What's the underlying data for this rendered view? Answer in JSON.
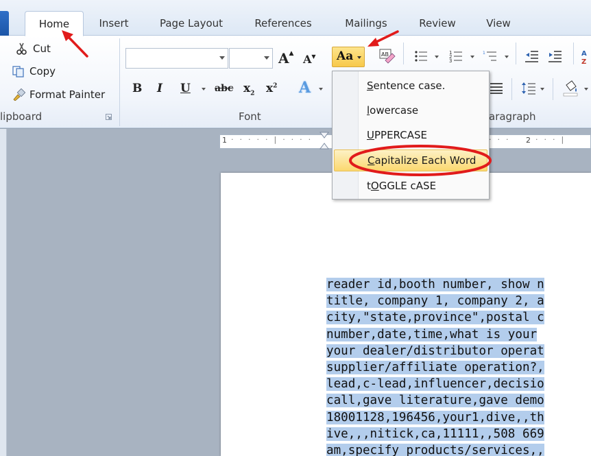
{
  "tabs": [
    {
      "label": "Home",
      "active": true
    },
    {
      "label": "Insert"
    },
    {
      "label": "Page Layout"
    },
    {
      "label": "References"
    },
    {
      "label": "Mailings"
    },
    {
      "label": "Review"
    },
    {
      "label": "View"
    }
  ],
  "clipboard": {
    "cut": "Cut",
    "copy": "Copy",
    "format_painter": "Format Painter",
    "group_label": "lipboard"
  },
  "font": {
    "group_label": "Font",
    "grow_label": "A",
    "shrink_label": "A",
    "change_case_label": "Aa",
    "bold": "B",
    "italic": "I",
    "underline": "U",
    "strikethrough": "abc",
    "subscript": "x",
    "superscript": "x",
    "text_effects": "A"
  },
  "paragraph": {
    "group_label": "aragraph"
  },
  "ruler": {
    "marks": [
      "1",
      "2"
    ]
  },
  "change_case_menu": {
    "items": [
      {
        "prefix": "",
        "ul": "S",
        "rest": "entence case."
      },
      {
        "prefix": "",
        "ul": "l",
        "rest": "owercase"
      },
      {
        "prefix": "",
        "ul": "U",
        "rest": "PPERCASE"
      },
      {
        "prefix": "",
        "ul": "C",
        "rest": "apitalize Each Word"
      },
      {
        "prefix": "t",
        "ul": "O",
        "rest": "GGLE cASE"
      }
    ],
    "highlighted_index": 3
  },
  "document": {
    "lines": [
      "reader id,booth number, show n",
      "title, company 1, company 2, a",
      "city,\"state,province\",postal c",
      "number,date,time,what is your",
      "your dealer/distributor operat",
      "supplier/affiliate operation?,",
      "lead,c-lead,influencer,decisio",
      "call,gave literature,gave demo",
      "18001128,196456,your1,dive,,th",
      "ive,,,nitick,ca,11111,,508 669",
      "am,specify products/services,,"
    ]
  },
  "colors": {
    "annotation_red": "#e11b1b",
    "selection": "#b3cdec",
    "menu_highlight": "#fbd86f"
  }
}
